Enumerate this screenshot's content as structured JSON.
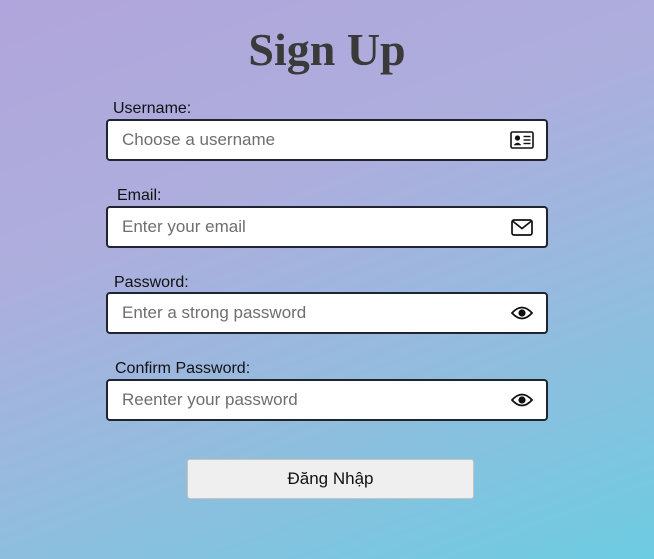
{
  "title": "Sign Up",
  "fields": [
    {
      "label": "Username:",
      "placeholder": "Choose a username",
      "icon": "id-card-icon"
    },
    {
      "label": "Email:",
      "placeholder": "Enter your email",
      "icon": "envelope-icon"
    },
    {
      "label": "Password:",
      "placeholder": "Enter a strong password",
      "icon": "eye-icon"
    },
    {
      "label": "Confirm Password:",
      "placeholder": "Reenter your password",
      "icon": "eye-icon"
    }
  ],
  "submit_label": "Đăng Nhập"
}
